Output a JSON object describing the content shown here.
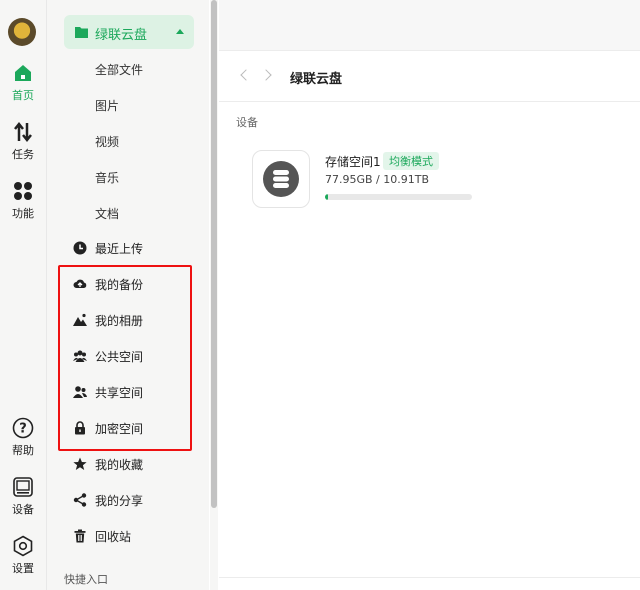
{
  "rail": {
    "items": [
      {
        "label": "首页",
        "icon": "home-icon",
        "active": true
      },
      {
        "label": "任务",
        "icon": "transfer-icon"
      },
      {
        "label": "功能",
        "icon": "apps-icon"
      },
      {
        "label": "帮助",
        "icon": "help-icon"
      },
      {
        "label": "设备",
        "icon": "device-icon"
      },
      {
        "label": "设置",
        "icon": "settings-icon"
      }
    ]
  },
  "sidebar": {
    "header": "绿联云盘",
    "sub_items": [
      "全部文件",
      "图片",
      "视频",
      "音乐",
      "文档"
    ],
    "nav_items": [
      {
        "label": "最近上传",
        "icon": "clock-icon"
      },
      {
        "label": "我的备份",
        "icon": "cloud-upload-icon"
      },
      {
        "label": "我的相册",
        "icon": "photo-icon"
      },
      {
        "label": "公共空间",
        "icon": "group-icon"
      },
      {
        "label": "共享空间",
        "icon": "share-users-icon"
      },
      {
        "label": "加密空间",
        "icon": "lock-icon"
      },
      {
        "label": "我的收藏",
        "icon": "star-icon"
      },
      {
        "label": "我的分享",
        "icon": "share-icon"
      },
      {
        "label": "回收站",
        "icon": "trash-icon"
      }
    ],
    "section_label": "快捷入口"
  },
  "main": {
    "breadcrumb_title": "绿联云盘",
    "section_label": "设备",
    "device": {
      "name": "存储空间1",
      "badge": "均衡模式",
      "size_text": "77.95GB / 10.91TB",
      "usage_fraction": 0.007
    }
  },
  "colors": {
    "accent": "#1ca85b",
    "highlight_box": "#e11111"
  }
}
